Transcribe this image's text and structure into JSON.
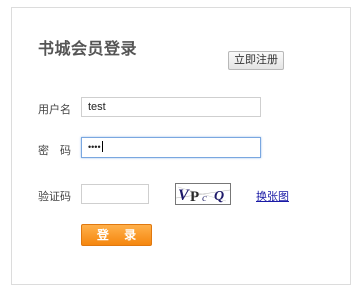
{
  "page": {
    "title": "书城会员登录",
    "register_label": "立即注册"
  },
  "form": {
    "username_label": "用户名",
    "username_value": "test",
    "password_label": "密　码",
    "password_mask": "••••",
    "captcha_label": "验证码",
    "captcha_value": "",
    "captcha_text": "VPcQ",
    "change_captcha_label": "换张图",
    "login_label": "登 录"
  },
  "colors": {
    "login_button": "#f5870f",
    "link": "#1a1aa6",
    "focus_border": "#7aa7e0"
  }
}
